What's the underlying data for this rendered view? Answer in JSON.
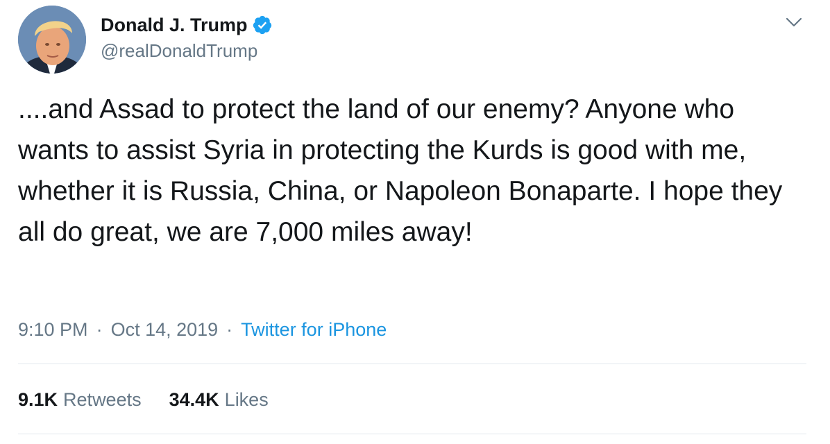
{
  "author": {
    "display_name": "Donald J. Trump",
    "handle": "@realDonaldTrump",
    "verified": true,
    "avatar_icon": "profile-photo",
    "verified_icon": "verified-badge-icon"
  },
  "tweet": {
    "text": "....and Assad to protect the land of our enemy? Anyone who wants to assist Syria in protecting the Kurds is good with me, whether it is Russia, China, or Napoleon Bonaparte. I hope they all do great, we are 7,000 miles away!",
    "time": "9:10 PM",
    "separator": "·",
    "date": "Oct 14, 2019",
    "source": "Twitter for iPhone"
  },
  "stats": {
    "retweets_count": "9.1K",
    "retweets_label": "Retweets",
    "likes_count": "34.4K",
    "likes_label": "Likes"
  },
  "menu": {
    "icon": "chevron-down-icon"
  },
  "colors": {
    "text": "#14171a",
    "secondary": "#657786",
    "link": "#1b95e0",
    "verified": "#1da1f2",
    "divider": "#e1e8ed"
  }
}
